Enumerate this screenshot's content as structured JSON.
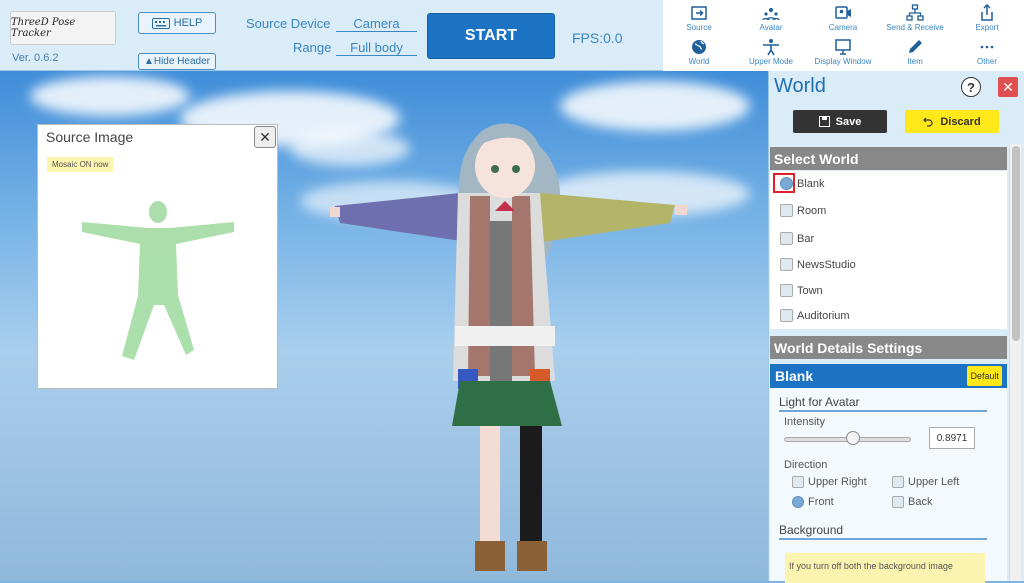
{
  "header": {
    "logo_text": "ThreeD Pose Tracker",
    "version": "Ver. 0.6.2",
    "help_label": "HELP",
    "hide_header_label": "▲Hide Header",
    "source_device_label": "Source Device",
    "source_device_value": "Camera",
    "range_label": "Range",
    "range_value": "Full body",
    "start_label": "START",
    "fps_label": "FPS:0.0"
  },
  "toolbar": {
    "items": [
      {
        "label": "Source",
        "icon": "source-icon"
      },
      {
        "label": "Avatar",
        "icon": "avatar-icon"
      },
      {
        "label": "Camera",
        "icon": "camera-icon"
      },
      {
        "label": "Send & Receive",
        "icon": "network-icon"
      },
      {
        "label": "Export",
        "icon": "export-icon"
      },
      {
        "label": "World",
        "icon": "globe-icon"
      },
      {
        "label": "Upper Mode",
        "icon": "upper-mode-icon"
      },
      {
        "label": "Display Window",
        "icon": "monitor-icon"
      },
      {
        "label": "Item",
        "icon": "pen-icon"
      },
      {
        "label": "Other",
        "icon": "more-icon"
      }
    ]
  },
  "source_panel": {
    "title": "Source Image",
    "close_label": "✕",
    "mosaic_label": "Mosaic ON now"
  },
  "world_panel": {
    "title": "World",
    "help_label": "?",
    "close_label": "✕",
    "save_label": "Save",
    "discard_label": "Discard",
    "select_world_header": "Select World",
    "worlds": [
      {
        "label": "Blank",
        "selected": true
      },
      {
        "label": "Room",
        "selected": false
      },
      {
        "label": "Bar",
        "selected": false
      },
      {
        "label": "NewsStudio",
        "selected": false
      },
      {
        "label": "Town",
        "selected": false
      },
      {
        "label": "Auditorium",
        "selected": false
      }
    ],
    "details_header": "World Details  Settings",
    "current_world": "Blank",
    "default_label": "Default",
    "light_header": "Light for Avatar",
    "intensity_label": "Intensity",
    "intensity_value": "0.8971",
    "direction_label": "Direction",
    "directions": [
      {
        "label": "Upper Right",
        "selected": false
      },
      {
        "label": "Upper Left",
        "selected": false
      },
      {
        "label": "Front",
        "selected": true
      },
      {
        "label": "Back",
        "selected": false
      }
    ],
    "background_header": "Background",
    "background_tip": "If you turn off both the background image"
  },
  "colors": {
    "accent": "#1c73c4",
    "header_bg": "#d9ecf8",
    "discard": "#ffe81a",
    "selection_outline": "#e0202a"
  }
}
